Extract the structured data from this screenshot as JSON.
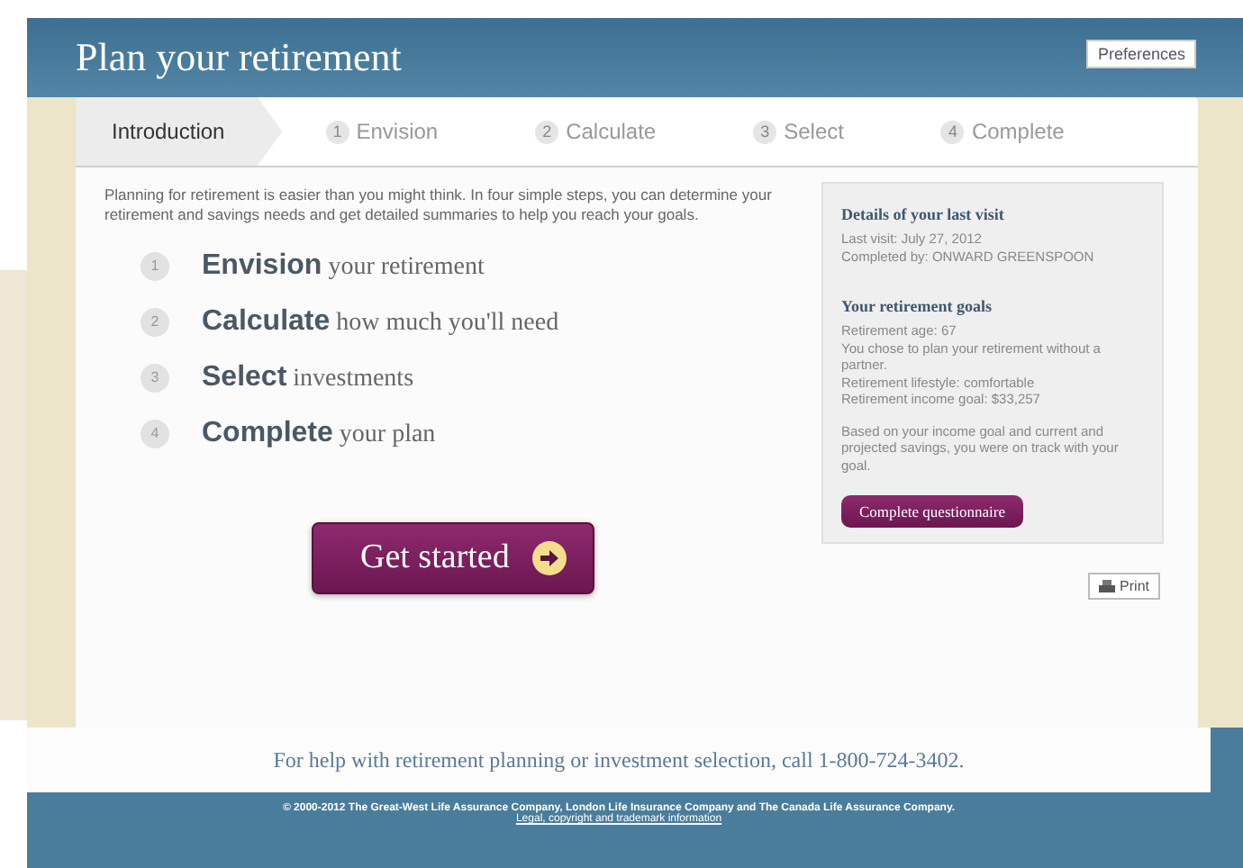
{
  "header": {
    "title": "Plan your retirement",
    "preferences_button": "Preferences"
  },
  "tabs": [
    {
      "label": "Introduction",
      "selected": true
    },
    {
      "number": "1",
      "label": "Envision",
      "selected": false
    },
    {
      "number": "2",
      "label": "Calculate",
      "selected": false
    },
    {
      "number": "3",
      "label": "Select",
      "selected": false
    },
    {
      "number": "4",
      "label": "Complete",
      "selected": false
    }
  ],
  "intro": "Planning for retirement is easier than you might think. In four simple steps, you can determine your retirement and savings needs and get detailed summaries to help you reach your goals.",
  "steps": [
    {
      "number": "1",
      "text": "**Envision** your retirement"
    },
    {
      "number": "2",
      "text": "**Calculate** how much you'll need"
    },
    {
      "number": "3",
      "text": "**Select** investments"
    },
    {
      "number": "4",
      "text": "**Complete** your plan"
    }
  ],
  "get_started_button": "Get started",
  "sidebar": {
    "sections": [
      {
        "title": "Details of your last visit",
        "paragraphs": [
          "Last visit: July 27, 2012\nCompleted by: ONWARD GREENSPOON"
        ]
      },
      {
        "title": "Your retirement goals",
        "paragraphs": [
          "Retirement age: 67\nYou chose to plan your retirement without a partner.\nRetirement lifestyle: comfortable\nRetirement income goal: $33,257",
          "Based on your income goal and current and projected savings, you were on track with your goal."
        ]
      }
    ],
    "button": "Complete questionnaire"
  },
  "print_button": "Print",
  "help_text": "For help with retirement planning or investment selection, call 1-800-724-3402.",
  "footer": {
    "copyright": "© 2000-2012 The Great-West Life Assurance Company, London Life Insurance Company and The Canada Life Assurance Company.",
    "link": "Legal, copyright and trademark information"
  }
}
